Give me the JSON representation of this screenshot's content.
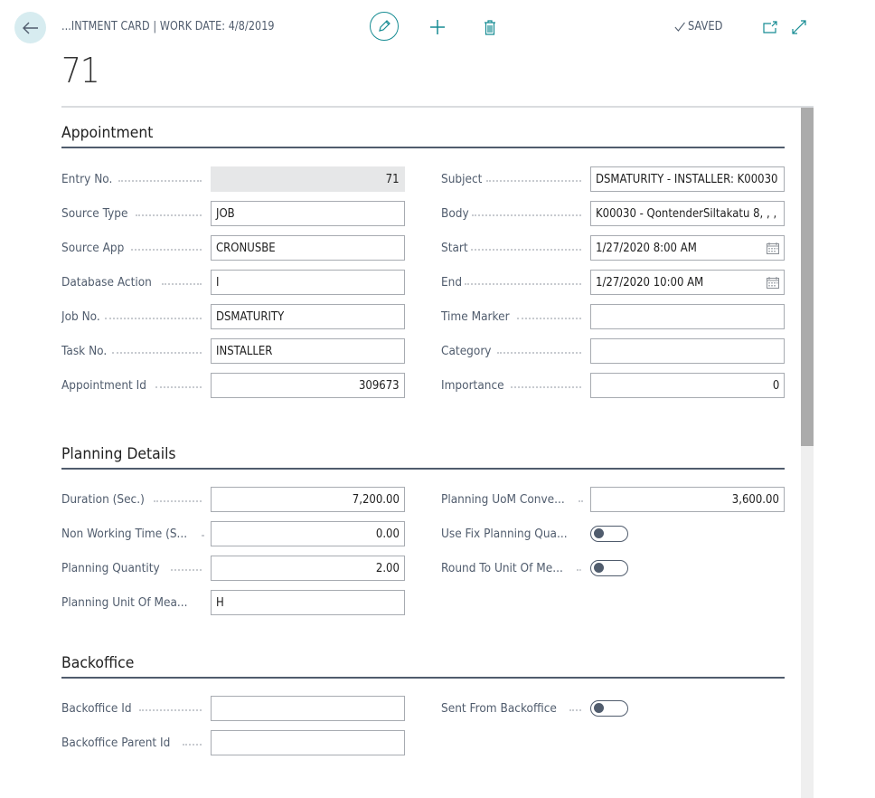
{
  "header": {
    "breadcrumb": "...INTMENT CARD | WORK DATE: 4/8/2019",
    "saved_status": "SAVED",
    "title": "71",
    "icons": {
      "back": "arrow-left-icon",
      "edit": "pencil-icon",
      "new": "plus-icon",
      "delete": "trash-icon",
      "saved": "checkmark-icon",
      "popout": "open-new-window-icon",
      "expand": "expand-icon"
    }
  },
  "colors": {
    "accent": "#168c93",
    "label": "#505c6d",
    "input_border": "#a7abb1",
    "readonly_bg": "#e6e7e8"
  },
  "sections": {
    "appointment": {
      "title": "Appointment",
      "left": [
        {
          "label": "Entry No.",
          "value": "71"
        },
        {
          "label": "Source Type",
          "value": "JOB"
        },
        {
          "label": "Source App",
          "value": "CRONUSBE"
        },
        {
          "label": "Database Action",
          "value": "I"
        },
        {
          "label": "Job No.",
          "value": "DSMATURITY"
        },
        {
          "label": "Task No.",
          "value": "INSTALLER"
        },
        {
          "label": "Appointment Id",
          "value": "309673"
        }
      ],
      "right": [
        {
          "label": "Subject",
          "value": "DSMATURITY - INSTALLER: K00030"
        },
        {
          "label": "Body",
          "value": "K00030 - QontenderSiltakatu 8, , ,"
        },
        {
          "label": "Start",
          "value": "1/27/2020 8:00 AM"
        },
        {
          "label": "End",
          "value": "1/27/2020 10:00 AM"
        },
        {
          "label": "Time Marker",
          "value": ""
        },
        {
          "label": "Category",
          "value": ""
        },
        {
          "label": "Importance",
          "value": "0"
        }
      ]
    },
    "planning": {
      "title": "Planning Details",
      "left": [
        {
          "label": "Duration (Sec.)",
          "value": "7,200.00"
        },
        {
          "label": "Non Working Time (S...",
          "value": "0.00"
        },
        {
          "label": "Planning Quantity",
          "value": "2.00"
        },
        {
          "label": "Planning Unit Of Mea...",
          "value": "H"
        }
      ],
      "right": [
        {
          "label": "Planning UoM Conve...",
          "value": "3,600.00"
        },
        {
          "label": "Use Fix Planning Qua...",
          "value": false
        },
        {
          "label": "Round To Unit Of Me...",
          "value": false
        }
      ]
    },
    "backoffice": {
      "title": "Backoffice",
      "left": [
        {
          "label": "Backoffice Id",
          "value": ""
        },
        {
          "label": "Backoffice Parent Id",
          "value": ""
        }
      ],
      "right": [
        {
          "label": "Sent From Backoffice",
          "value": false
        }
      ]
    }
  }
}
